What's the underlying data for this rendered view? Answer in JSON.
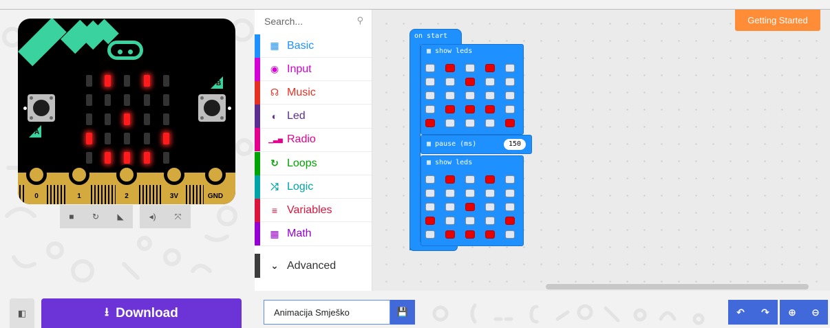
{
  "simulator": {
    "button_a": "A",
    "button_b": "B",
    "led_matrix": [
      [
        0,
        1,
        0,
        1,
        0
      ],
      [
        0,
        0,
        0,
        0,
        0
      ],
      [
        0,
        0,
        1,
        0,
        0
      ],
      [
        1,
        0,
        0,
        0,
        1
      ],
      [
        0,
        1,
        1,
        1,
        0
      ]
    ],
    "pins": [
      "0",
      "1",
      "2",
      "3V",
      "GND"
    ],
    "controls": [
      "stop-icon",
      "restart-icon",
      "debug-icon",
      "mute-icon",
      "fullscreen-icon"
    ]
  },
  "download": {
    "label": "Download"
  },
  "toolbox": {
    "search_placeholder": "Search...",
    "categories": [
      {
        "label": "Basic",
        "color": "#1e90ff",
        "icon": "grid-icon"
      },
      {
        "label": "Input",
        "color": "#d400d4",
        "icon": "target-icon"
      },
      {
        "label": "Music",
        "color": "#e63022",
        "icon": "headphones-icon"
      },
      {
        "label": "Led",
        "color": "#5c2d91",
        "icon": "toggle-icon"
      },
      {
        "label": "Radio",
        "color": "#e3008c",
        "icon": "signal-icon"
      },
      {
        "label": "Loops",
        "color": "#00a400",
        "icon": "refresh-icon"
      },
      {
        "label": "Logic",
        "color": "#00a4a6",
        "icon": "shuffle-icon"
      },
      {
        "label": "Variables",
        "color": "#dc143c",
        "icon": "lines-icon"
      },
      {
        "label": "Math",
        "color": "#9400d3",
        "icon": "calculator-icon"
      }
    ],
    "advanced": "Advanced"
  },
  "workspace": {
    "getting_started": "Getting Started",
    "on_start": "on start",
    "show_leds_1": "show leds",
    "pattern_1": [
      [
        0,
        1,
        0,
        1,
        0
      ],
      [
        0,
        0,
        1,
        0,
        0
      ],
      [
        0,
        0,
        0,
        0,
        0
      ],
      [
        0,
        1,
        1,
        1,
        0
      ],
      [
        1,
        0,
        0,
        0,
        1
      ]
    ],
    "pause_label": "pause (ms)",
    "pause_value": "150",
    "show_leds_2": "show leds",
    "pattern_2": [
      [
        0,
        1,
        0,
        1,
        0
      ],
      [
        0,
        0,
        0,
        0,
        0
      ],
      [
        0,
        0,
        1,
        0,
        0
      ],
      [
        1,
        0,
        0,
        0,
        1
      ],
      [
        0,
        1,
        1,
        1,
        0
      ]
    ]
  },
  "project": {
    "name": "Animacija Smješko"
  }
}
